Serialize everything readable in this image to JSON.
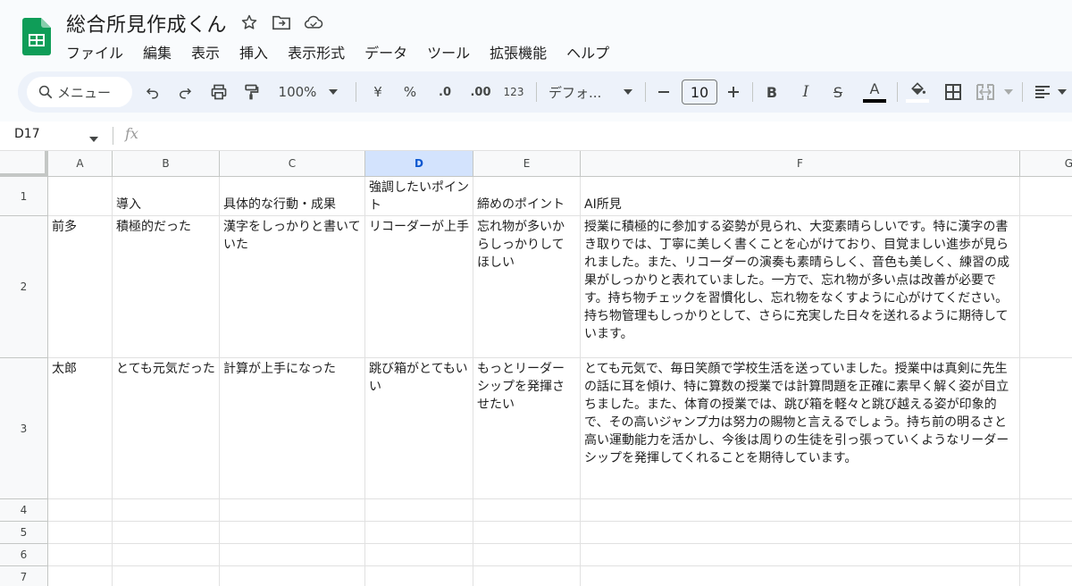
{
  "app": {
    "title": "総合所見作成くん",
    "brand_color": "#0f9d58"
  },
  "menu": [
    "ファイル",
    "編集",
    "表示",
    "挿入",
    "表示形式",
    "データ",
    "ツール",
    "拡張機能",
    "ヘルプ"
  ],
  "toolbar": {
    "search_label": "メニュー",
    "zoom": "100%",
    "currency": "¥",
    "percent": "%",
    "dec_decrease": ".0",
    "dec_increase": ".00",
    "number_format": "123",
    "font_name": "デフォ...",
    "font_size": "10",
    "bold": "B",
    "italic": "I",
    "strike": "S",
    "text_color": "A"
  },
  "formula_bar": {
    "name_box": "D17",
    "fx": "fx"
  },
  "sheet": {
    "columns": [
      "A",
      "B",
      "C",
      "D",
      "E",
      "F",
      "G"
    ],
    "selected_column": "D",
    "row_numbers": [
      "1",
      "2",
      "3",
      "4",
      "5",
      "6",
      "7"
    ],
    "rows": [
      [
        "",
        "導入",
        "具体的な行動・成果",
        "強調したいポイント",
        "締めのポイント",
        "AI所見"
      ],
      [
        "前多",
        "積極的だった",
        "漢字をしっかりと書いていた",
        "リコーダーが上手",
        "忘れ物が多いからしっかりしてほしい",
        "授業に積極的に参加する姿勢が見られ、大変素晴らしいです。特に漢字の書き取りでは、丁寧に美しく書くことを心がけており、目覚ましい進歩が見られました。また、リコーダーの演奏も素晴らしく、音色も美しく、練習の成果がしっかりと表れていました。一方で、忘れ物が多い点は改善が必要です。持ち物チェックを習慣化し、忘れ物をなくすように心がけてください。持ち物管理もしっかりとして、さらに充実した日々を送れるように期待しています。"
      ],
      [
        "太郎",
        "とても元気だった",
        "計算が上手になった",
        "跳び箱がとてもいい",
        "もっとリーダーシップを発揮させたい",
        "とても元気で、毎日笑顔で学校生活を送っていました。授業中は真剣に先生の話に耳を傾け、特に算数の授業では計算問題を正確に素早く解く姿が目立ちました。また、体育の授業では、跳び箱を軽々と跳び越える姿が印象的で、その高いジャンプ力は努力の賜物と言えるでしょう。持ち前の明るさと高い運動能力を活かし、今後は周りの生徒を引っ張っていくようなリーダーシップを発揮してくれることを期待しています。"
      ]
    ]
  }
}
